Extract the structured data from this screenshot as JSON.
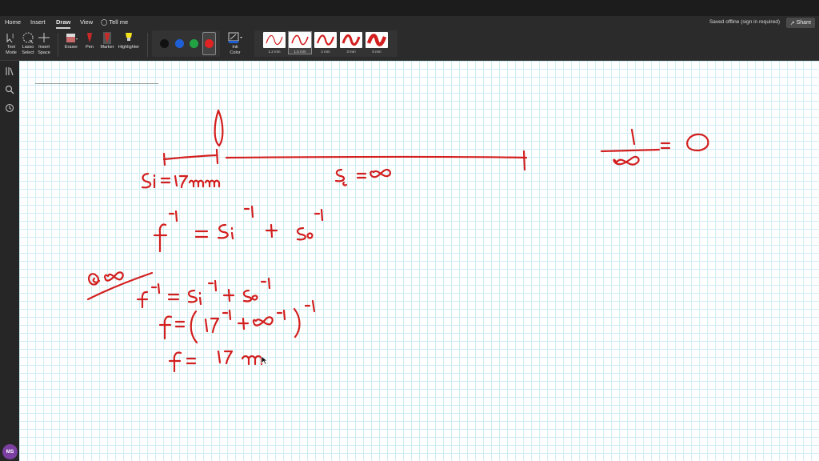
{
  "menu": {
    "tabs": [
      {
        "label": "Home"
      },
      {
        "label": "Insert"
      },
      {
        "label": "Draw"
      },
      {
        "label": "View"
      },
      {
        "label": "Tell me"
      }
    ],
    "active_tab": "Draw",
    "status": "Saved offline (sign in required)",
    "share_label": "Share"
  },
  "ribbon": {
    "tools": {
      "text_mode": "Text\nMode",
      "lasso_select": "Lasso\nSelect",
      "insert_space": "Insert\nSpace",
      "eraser": "Eraser",
      "pen": "Pen",
      "marker": "Marker",
      "highlighter": "Highlighter",
      "ink_color": "Ink\nColor"
    },
    "colors": [
      "#111111",
      "#1f5fd6",
      "#21a344",
      "#e02424"
    ],
    "selected_color": "#e02424",
    "pen_sizes": [
      {
        "label": "1.2 mm"
      },
      {
        "label": "1.5 mm"
      },
      {
        "label": "2 mm"
      },
      {
        "label": "3 mm"
      },
      {
        "label": "5 mm"
      }
    ],
    "selected_pen_size": "1.5 mm"
  },
  "sidebar": {
    "icons": [
      "library-icon",
      "search-icon",
      "recent-icon"
    ]
  },
  "user": {
    "initials": "MS"
  },
  "accent_color": "#d21f1f"
}
